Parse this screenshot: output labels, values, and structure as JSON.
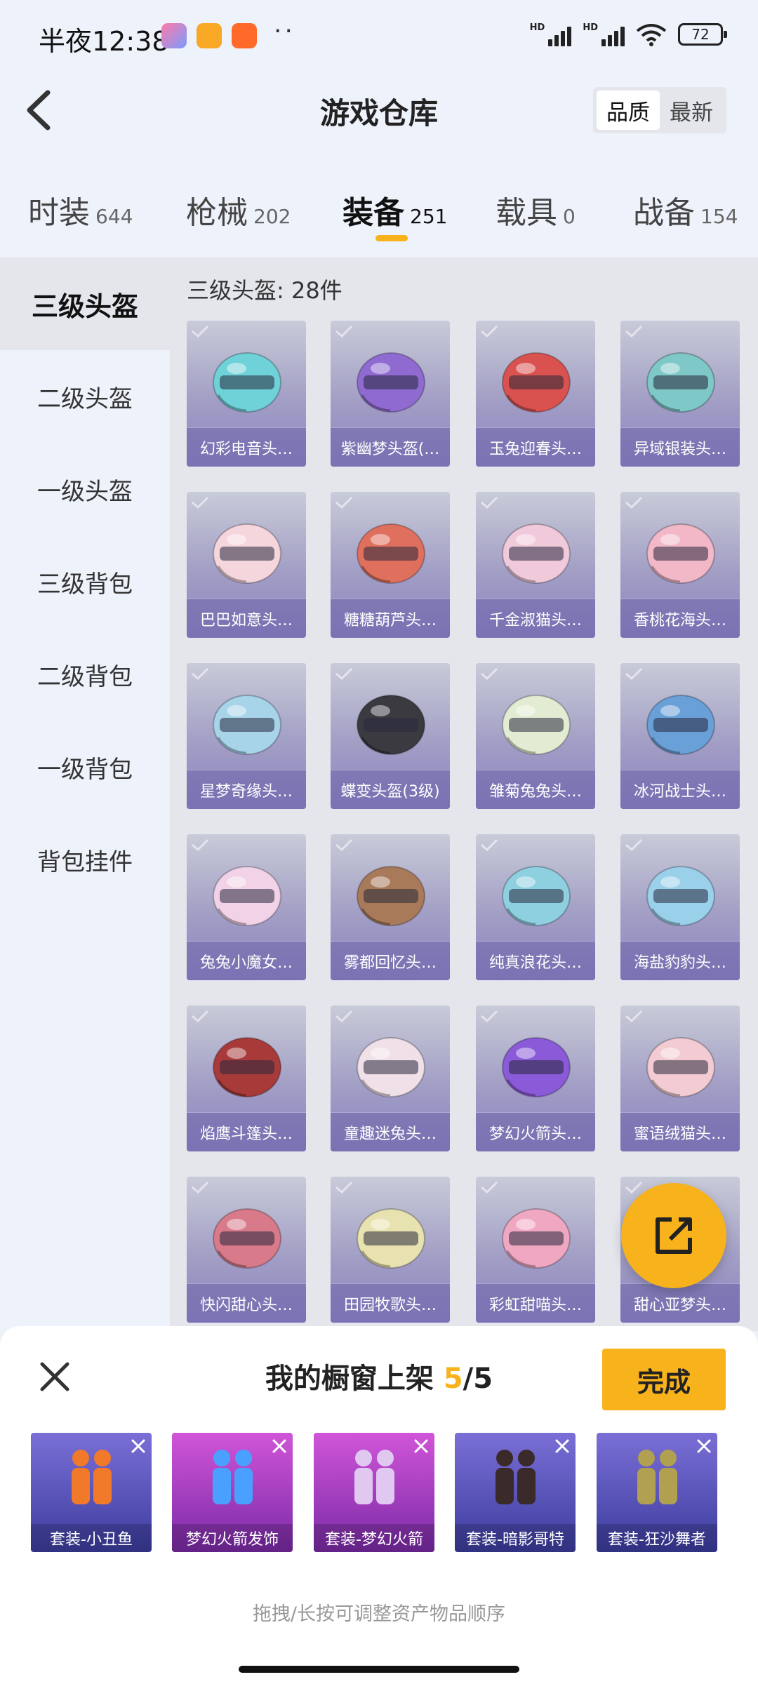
{
  "status": {
    "time": "半夜12:38",
    "dots": "··",
    "battery": "72"
  },
  "header": {
    "title": "游戏仓库",
    "sort_options": [
      "品质",
      "最新"
    ],
    "active_sort": "品质"
  },
  "tabs": [
    {
      "label": "时装",
      "count": "644"
    },
    {
      "label": "枪械",
      "count": "202"
    },
    {
      "label": "装备",
      "count": "251",
      "active": true
    },
    {
      "label": "载具",
      "count": "0"
    },
    {
      "label": "战备",
      "count": "154"
    }
  ],
  "sidebar": {
    "items": [
      "三级头盔",
      "二级头盔",
      "一级头盔",
      "三级背包",
      "二级背包",
      "一级背包",
      "背包挂件"
    ],
    "active": "三级头盔"
  },
  "section": {
    "title": "三级头盔: 28件"
  },
  "items": [
    {
      "name": "幻彩电音头…",
      "color": "#6fd2d8"
    },
    {
      "name": "紫幽梦头盔(…",
      "color": "#8f6ad0"
    },
    {
      "name": "玉兔迎春头…",
      "color": "#d9524f"
    },
    {
      "name": "异域银装头…",
      "color": "#7fc8c8"
    },
    {
      "name": "巴巴如意头…",
      "color": "#f4d6dc"
    },
    {
      "name": "糖糖葫芦头…",
      "color": "#e0705e"
    },
    {
      "name": "千金淑猫头…",
      "color": "#f0cadb"
    },
    {
      "name": "香桃花海头…",
      "color": "#f2b8c8"
    },
    {
      "name": "星梦奇缘头…",
      "color": "#a8d4ea"
    },
    {
      "name": "蝶变头盔(3级)",
      "color": "#3a3a40"
    },
    {
      "name": "雏菊兔兔头…",
      "color": "#e2ecd2"
    },
    {
      "name": "冰河战士头…",
      "color": "#6aa0d8"
    },
    {
      "name": "兔兔小魔女…",
      "color": "#f2d2e6"
    },
    {
      "name": "雾都回忆头…",
      "color": "#a87a5a"
    },
    {
      "name": "纯真浪花头…",
      "color": "#8fd0e0"
    },
    {
      "name": "海盐豹豹头…",
      "color": "#9ad0ea"
    },
    {
      "name": "焰鹰斗篷头…",
      "color": "#a83a3a"
    },
    {
      "name": "童趣迷兔头…",
      "color": "#f0e0e8"
    },
    {
      "name": "梦幻火箭头…",
      "color": "#8a5ad8"
    },
    {
      "name": "蜜语绒猫头…",
      "color": "#f2ccd2"
    },
    {
      "name": "快闪甜心头…",
      "color": "#d87a8a"
    },
    {
      "name": "田园牧歌头…",
      "color": "#e8e2b0"
    },
    {
      "name": "彩虹甜喵头…",
      "color": "#f0a8c2"
    },
    {
      "name": "甜心亚梦头…",
      "color": "#e8c8e0"
    }
  ],
  "panel": {
    "title_prefix": "我的橱窗上架 ",
    "current": "5",
    "total": "/5",
    "done_label": "完成",
    "hint": "拖拽/长按可调整资产物品顺序",
    "items": [
      {
        "name": "套装-小丑鱼",
        "bg": "blue",
        "color": "#f07a2a"
      },
      {
        "name": "梦幻火箭发饰",
        "bg": "purple",
        "color": "#4aa0ff"
      },
      {
        "name": "套装-梦幻火箭",
        "bg": "purple",
        "color": "#e0c8f0"
      },
      {
        "name": "套装-暗影哥特",
        "bg": "blue",
        "color": "#3a2a2a"
      },
      {
        "name": "套装-狂沙舞者",
        "bg": "blue",
        "color": "#b0a050"
      }
    ]
  },
  "accent": "#f7b21c"
}
